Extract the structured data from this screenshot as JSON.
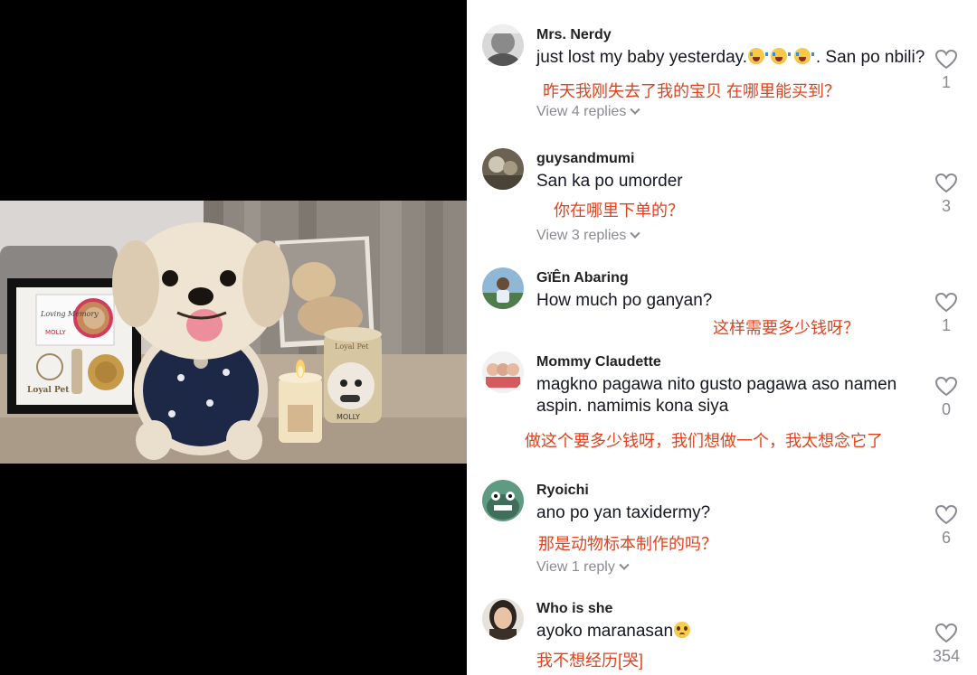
{
  "comments": [
    {
      "username": "Mrs. Nerdy",
      "text_before": "just lost my baby yesterday.",
      "text_after": ". San po nbili?",
      "emojis": [
        "loudly-crying-face-emoji",
        "loudly-crying-face-emoji",
        "loudly-crying-face-emoji"
      ],
      "translation": "昨天我刚失去了我的宝贝  在哪里能买到？",
      "replies": "View 4 replies",
      "likes": "1"
    },
    {
      "username": "guysandmumi",
      "text": "San ka po umorder",
      "translation": "你在哪里下单的？",
      "replies": "View 3 replies",
      "likes": "3"
    },
    {
      "username": "GïÊn Abaring",
      "text": "How much po ganyan?",
      "translation": "这样需要多少钱呀？",
      "likes": "1"
    },
    {
      "username": "Mommy Claudette",
      "text": "magkno pagawa nito gusto pagawa aso namen aspin. namimis kona siya",
      "translation": "做这个要多少钱呀，我们想做一个，我太想念它了",
      "likes": "0"
    },
    {
      "username": "Ryoichi",
      "text": "ano po yan taxidermy?",
      "translation": "那是动物标本制作的吗？",
      "replies": "View 1 reply",
      "likes": "6"
    },
    {
      "username": "Who is she",
      "text": "ayoko maranasan",
      "emojis": [
        "pleading-face-emoji"
      ],
      "translation": "我不想经历[哭]",
      "likes": "354"
    }
  ],
  "photo": {
    "frame_lettering": [
      "Loving Memory",
      "MOLLY",
      "Loyal Pet"
    ],
    "jar_lettering": [
      "Loyal Pet",
      "MOLLY"
    ]
  },
  "colors": {
    "translation": "#e0421c",
    "muted": "#8a8b91",
    "text": "#161823"
  }
}
